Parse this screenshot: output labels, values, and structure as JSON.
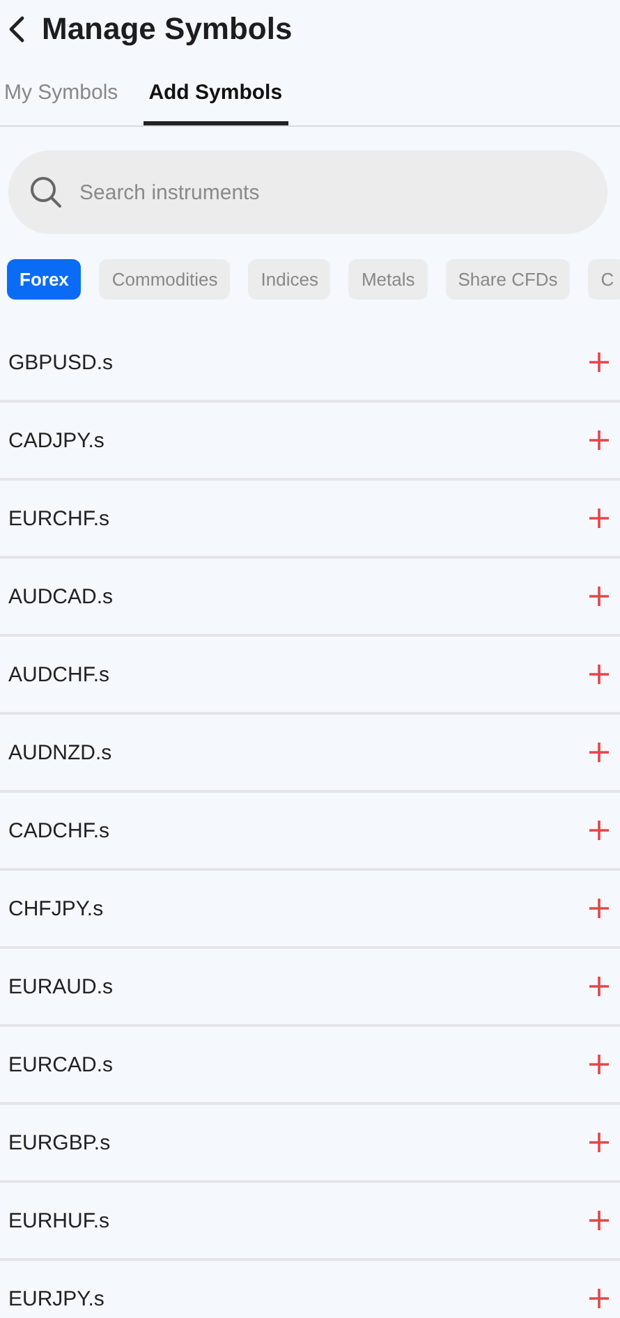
{
  "header": {
    "title": "Manage Symbols"
  },
  "tabs": [
    {
      "label": "My Symbols",
      "selected": false
    },
    {
      "label": "Add Symbols",
      "selected": true
    }
  ],
  "search": {
    "placeholder": "Search instruments"
  },
  "categories": [
    {
      "label": "Forex",
      "selected": true
    },
    {
      "label": "Commodities",
      "selected": false
    },
    {
      "label": "Indices",
      "selected": false
    },
    {
      "label": "Metals",
      "selected": false
    },
    {
      "label": "Share CFDs",
      "selected": false
    },
    {
      "label": "C",
      "selected": false
    }
  ],
  "symbols": [
    {
      "name": "GBPUSD.s"
    },
    {
      "name": "CADJPY.s"
    },
    {
      "name": "EURCHF.s"
    },
    {
      "name": "AUDCAD.s"
    },
    {
      "name": "AUDCHF.s"
    },
    {
      "name": "AUDNZD.s"
    },
    {
      "name": "CADCHF.s"
    },
    {
      "name": "CHFJPY.s"
    },
    {
      "name": "EURAUD.s"
    },
    {
      "name": "EURCAD.s"
    },
    {
      "name": "EURGBP.s"
    },
    {
      "name": "EURHUF.s"
    },
    {
      "name": "EURJPY.s"
    }
  ]
}
